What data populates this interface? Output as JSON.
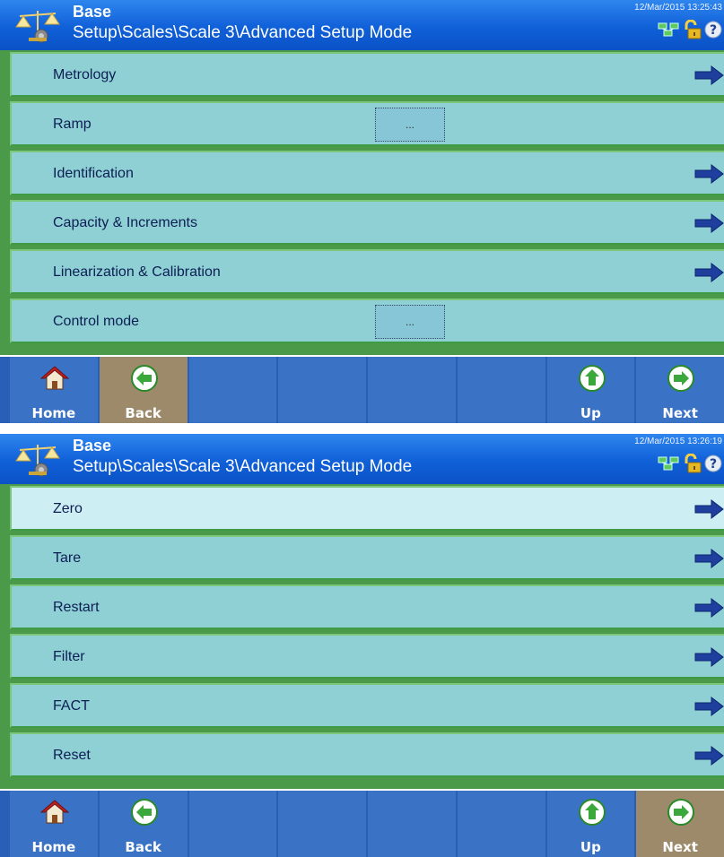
{
  "screens": [
    {
      "header": {
        "app_name": "Base",
        "breadcrumb": "Setup\\Scales\\Scale 3\\Advanced Setup Mode",
        "datetime": "12/Mar/2015 13:25:43"
      },
      "menu": [
        {
          "label": "Metrology",
          "control": "arrow"
        },
        {
          "label": "Ramp",
          "control": "value",
          "value": "..."
        },
        {
          "label": "Identification",
          "control": "arrow"
        },
        {
          "label": "Capacity & Increments",
          "control": "arrow"
        },
        {
          "label": "Linearization & Calibration",
          "control": "arrow"
        },
        {
          "label": "Control mode",
          "control": "value",
          "value": "..."
        }
      ],
      "softkeys": [
        {
          "label": "Home",
          "icon": "home-icon"
        },
        {
          "label": "Back",
          "icon": "back-arrow-icon",
          "highlight": true
        },
        {
          "label": "",
          "icon": ""
        },
        {
          "label": "",
          "icon": ""
        },
        {
          "label": "",
          "icon": ""
        },
        {
          "label": "",
          "icon": ""
        },
        {
          "label": "Up",
          "icon": "up-arrow-icon"
        },
        {
          "label": "Next",
          "icon": "next-arrow-icon"
        }
      ]
    },
    {
      "header": {
        "app_name": "Base",
        "breadcrumb": "Setup\\Scales\\Scale 3\\Advanced Setup Mode",
        "datetime": "12/Mar/2015 13:26:19"
      },
      "menu": [
        {
          "label": "Zero",
          "control": "arrow",
          "selected": true
        },
        {
          "label": "Tare",
          "control": "arrow"
        },
        {
          "label": "Restart",
          "control": "arrow"
        },
        {
          "label": "Filter",
          "control": "arrow"
        },
        {
          "label": "FACT",
          "control": "arrow"
        },
        {
          "label": "Reset",
          "control": "arrow"
        }
      ],
      "softkeys": [
        {
          "label": "Home",
          "icon": "home-icon"
        },
        {
          "label": "Back",
          "icon": "back-arrow-icon"
        },
        {
          "label": "",
          "icon": ""
        },
        {
          "label": "",
          "icon": ""
        },
        {
          "label": "",
          "icon": ""
        },
        {
          "label": "",
          "icon": ""
        },
        {
          "label": "Up",
          "icon": "up-arrow-icon"
        },
        {
          "label": "Next",
          "icon": "next-arrow-icon",
          "highlight": true
        }
      ]
    }
  ],
  "colors": {
    "header": "#1060d8",
    "row": "#8ed0d3",
    "row_selected": "#cdeff4",
    "row_text": "#0d1e55",
    "softkey": "#3a72c6",
    "softkey_highlight": "#9c8a6a",
    "arrow": "#1f3f9e"
  }
}
